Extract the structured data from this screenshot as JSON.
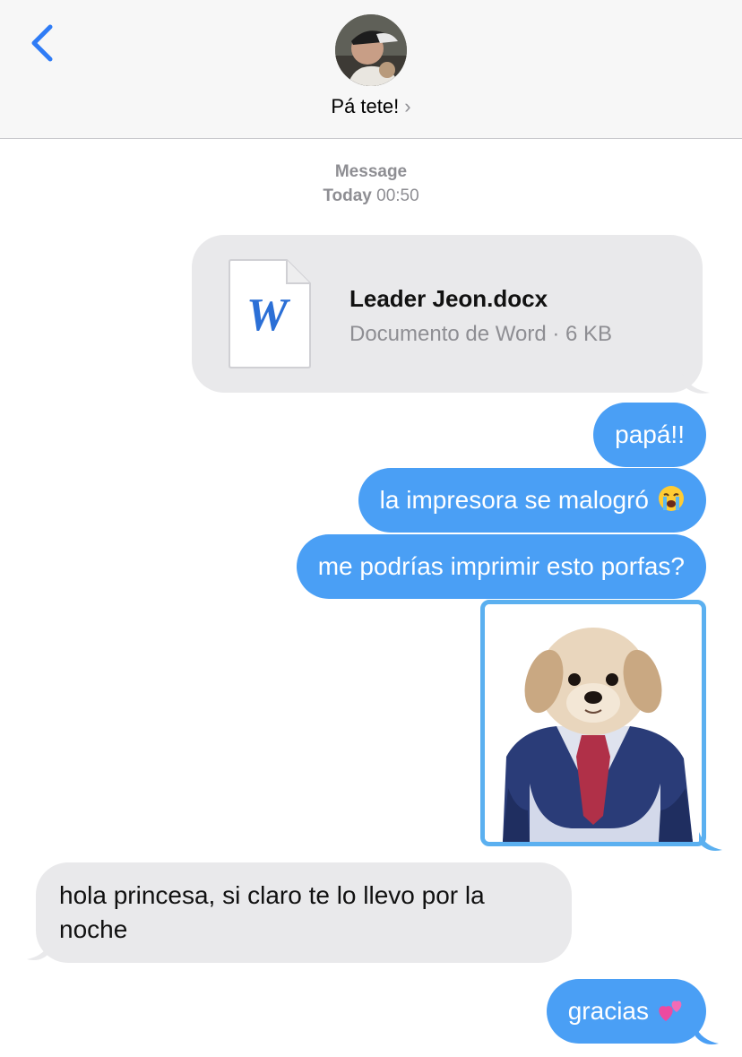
{
  "header": {
    "contact_name": "Pá tete!",
    "chevron": "›",
    "back_icon": "chevron-left-icon"
  },
  "thread": {
    "label": "Message",
    "day": "Today",
    "time": "00:50"
  },
  "attachment": {
    "file_name": "Leader Jeon.docx",
    "meta": "Documento de Word · 6 KB",
    "icon_letter": "W",
    "icon_color": "#2b6fd6"
  },
  "messages": {
    "m1": "papá!!",
    "m2": "la impresora se malogró",
    "m3": "me podrías imprimir esto porfas?",
    "reply": "hola princesa, si claro te lo llevo por la noche",
    "m5": "gracias"
  },
  "colors": {
    "sent": "#4a9ff5",
    "received": "#e9e9eb",
    "accent": "#2f7cf6"
  }
}
